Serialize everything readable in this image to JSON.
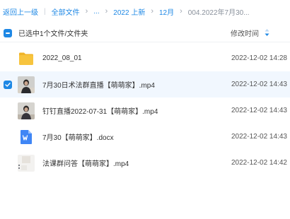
{
  "breadcrumb": {
    "back": "返回上一级",
    "all_files": "全部文件",
    "ellipsis": "...",
    "folder_2022": "2022 上新",
    "folder_dec": "12月",
    "current": "004.2022年7月30..."
  },
  "header": {
    "selection_text": "已选中1个文件/文件夹",
    "sort_column": "修改时间"
  },
  "files": [
    {
      "name": "2022_08_01",
      "modified": "2022-12-02 14:28",
      "type": "folder",
      "icon": "folder-icon",
      "selected": false
    },
    {
      "name": "7月30日术法群直播【萌萌家】.mp4",
      "modified": "2022-12-02 14:43",
      "type": "video",
      "icon": "video-thumbnail",
      "selected": true
    },
    {
      "name": "钉钉直播2022-07-31【萌萌家】.mp4",
      "modified": "2022-12-02 14:43",
      "type": "video",
      "icon": "video-thumbnail",
      "selected": false
    },
    {
      "name": "7月30【萌萌家】.docx",
      "modified": "2022-12-02 14:43",
      "type": "docx",
      "icon": "word-doc-icon",
      "selected": false
    },
    {
      "name": "法课群问答【萌萌家】.mp4",
      "modified": "2022-12-02 14:42",
      "type": "video",
      "icon": "video-thumbnail",
      "selected": false
    }
  ],
  "colors": {
    "accent": "#1e88e5",
    "selected_row": "#f1f7fe",
    "folder": "#f7c43e",
    "word": "#3f86f5"
  }
}
